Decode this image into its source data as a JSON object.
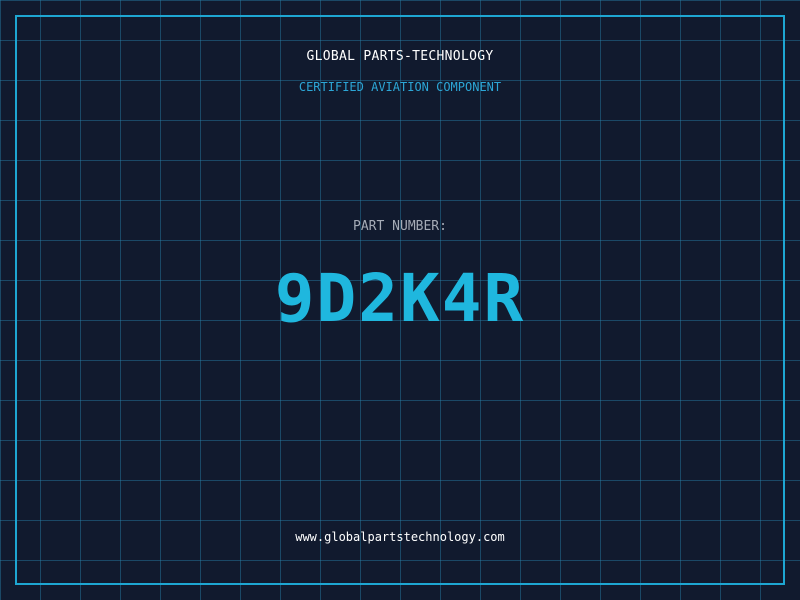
{
  "header": {
    "company": "GLOBAL PARTS-TECHNOLOGY",
    "subtitle": "CERTIFIED AVIATION COMPONENT"
  },
  "part": {
    "label": "PART NUMBER:",
    "number": "9D2K4R"
  },
  "footer": {
    "url": "www.globalpartstechnology.com"
  },
  "colors": {
    "background": "#111a2e",
    "grid": "#2882aa",
    "accent": "#1ea6d2",
    "heading": "#ffffff",
    "muted": "#a5abb6"
  }
}
